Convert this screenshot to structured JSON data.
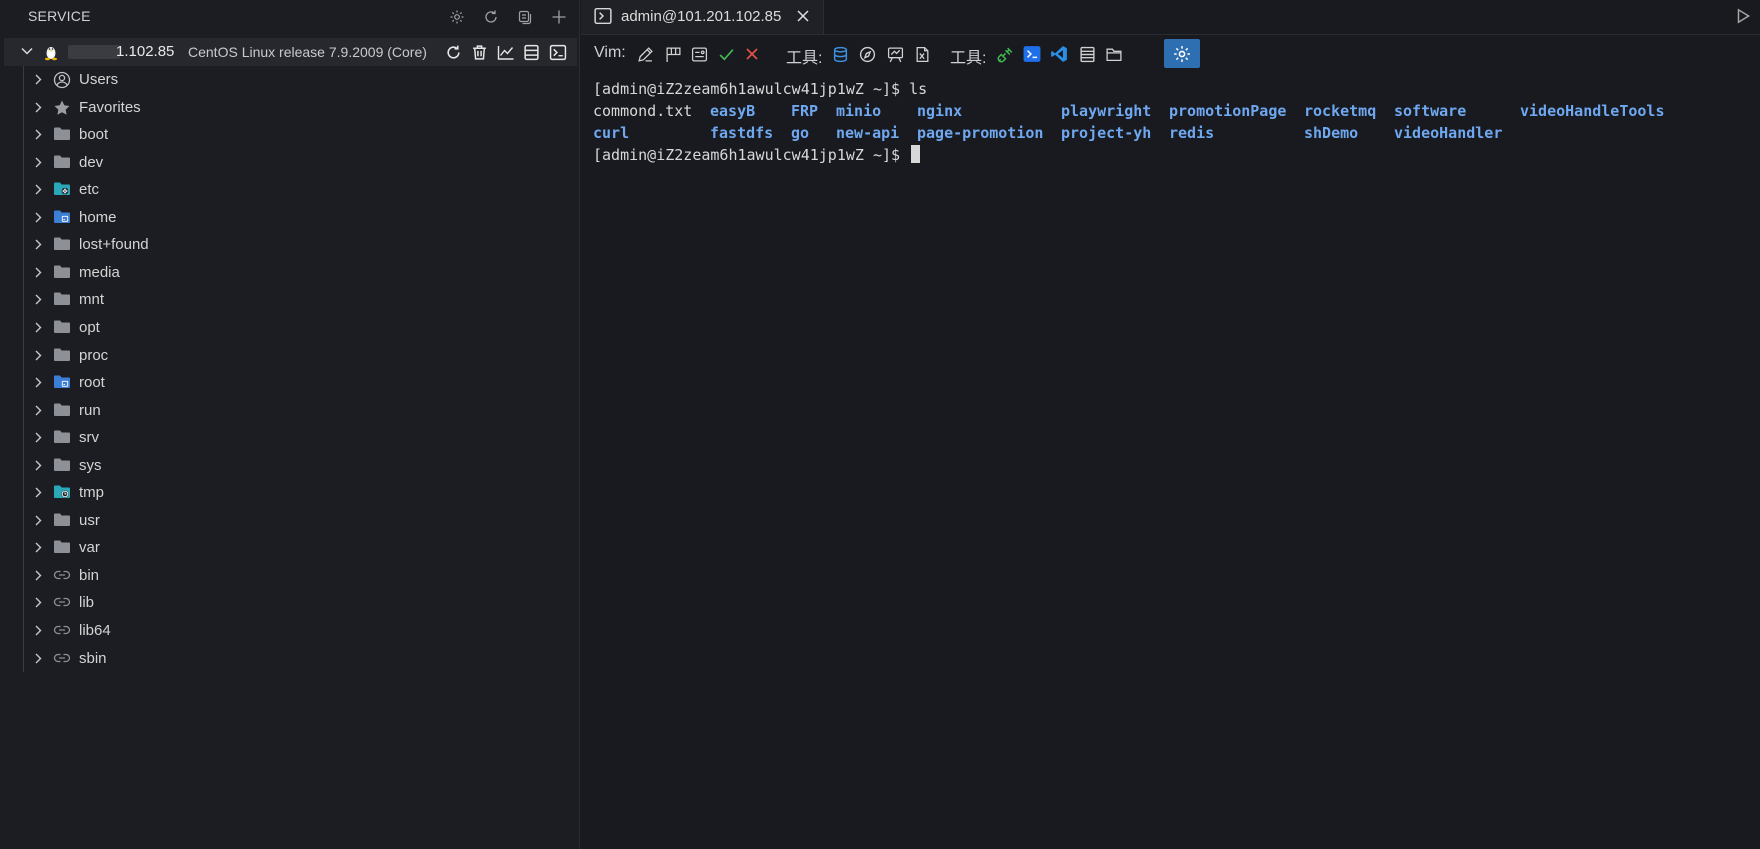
{
  "sidebar": {
    "title": "SERVICE",
    "header_icons": [
      "gear-icon",
      "refresh-icon",
      "copy-icon",
      "plus-icon"
    ],
    "server": {
      "ip": "1.102.85",
      "os": "CentOS Linux release 7.9.2009 (Core)",
      "actions": [
        "refresh-icon",
        "trash-icon",
        "chart-icon",
        "server-list-icon",
        "terminal-icon"
      ]
    },
    "tree": [
      {
        "label": "Users",
        "icon": "user-icon"
      },
      {
        "label": "Favorites",
        "icon": "star-icon"
      },
      {
        "label": "boot",
        "icon": "folder-icon"
      },
      {
        "label": "dev",
        "icon": "folder-icon"
      },
      {
        "label": "etc",
        "icon": "folder-settings-icon"
      },
      {
        "label": "home",
        "icon": "folder-home-icon"
      },
      {
        "label": "lost+found",
        "icon": "folder-icon"
      },
      {
        "label": "media",
        "icon": "folder-icon"
      },
      {
        "label": "mnt",
        "icon": "folder-icon"
      },
      {
        "label": "opt",
        "icon": "folder-icon"
      },
      {
        "label": "proc",
        "icon": "folder-icon"
      },
      {
        "label": "root",
        "icon": "folder-home-icon"
      },
      {
        "label": "run",
        "icon": "folder-icon"
      },
      {
        "label": "srv",
        "icon": "folder-icon"
      },
      {
        "label": "sys",
        "icon": "folder-icon"
      },
      {
        "label": "tmp",
        "icon": "folder-clock-icon"
      },
      {
        "label": "usr",
        "icon": "folder-icon"
      },
      {
        "label": "var",
        "icon": "folder-icon"
      },
      {
        "label": "bin",
        "icon": "link-icon"
      },
      {
        "label": "lib",
        "icon": "link-icon"
      },
      {
        "label": "lib64",
        "icon": "link-icon"
      },
      {
        "label": "sbin",
        "icon": "link-icon"
      }
    ]
  },
  "tab": {
    "label": "admin@101.201.102.85"
  },
  "toolbar": {
    "vim_label": "Vim:",
    "tools_label_1": "工具:",
    "tools_label_2": "工具:"
  },
  "terminal": {
    "prompt": "[admin@iZ2zeam6h1awulcw41jp1wZ ~]$",
    "command": "ls",
    "row1": [
      {
        "name": "commond.txt",
        "kind": "file"
      },
      {
        "name": "easyB",
        "kind": "dir"
      },
      {
        "name": "FRP",
        "kind": "dir"
      },
      {
        "name": "minio",
        "kind": "dir"
      },
      {
        "name": "nginx",
        "kind": "dir"
      },
      {
        "name": "playwright",
        "kind": "dir"
      },
      {
        "name": "promotionPage",
        "kind": "dir"
      },
      {
        "name": "rocketmq",
        "kind": "dir"
      },
      {
        "name": "software",
        "kind": "dir"
      },
      {
        "name": "videoHandleTools",
        "kind": "dir"
      }
    ],
    "row2": [
      {
        "name": "curl",
        "kind": "dir"
      },
      {
        "name": "fastdfs",
        "kind": "dir"
      },
      {
        "name": "go",
        "kind": "dir"
      },
      {
        "name": "new-api",
        "kind": "dir"
      },
      {
        "name": "page-promotion",
        "kind": "dir"
      },
      {
        "name": "project-yh",
        "kind": "dir"
      },
      {
        "name": "redis",
        "kind": "dir"
      },
      {
        "name": "shDemo",
        "kind": "dir"
      },
      {
        "name": "videoHandler",
        "kind": "dir"
      }
    ]
  },
  "colors": {
    "directory": "#6fa8f0",
    "accent": "#2d6fb0",
    "background": "#181a1f"
  }
}
